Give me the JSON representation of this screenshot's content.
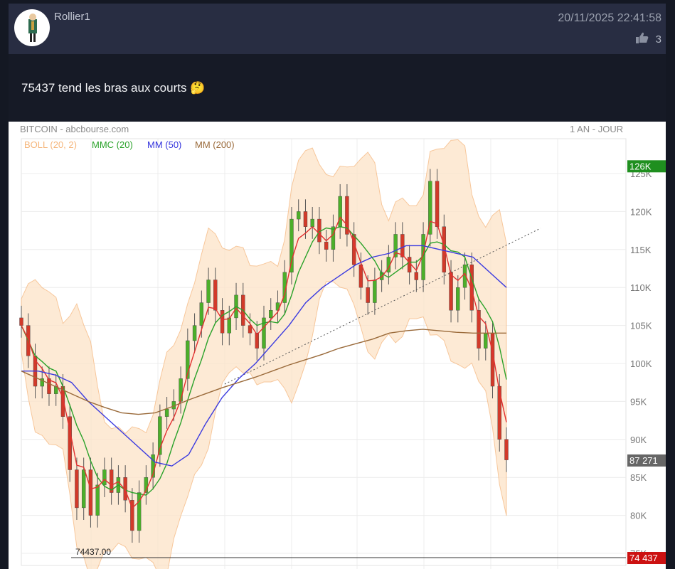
{
  "post": {
    "username": "Rollier1",
    "timestamp": "20/11/2025 22:41:58",
    "likes": "3",
    "message": "75437 tend les bras aux courts",
    "emoji": "🤔"
  },
  "chart_data": {
    "type": "candlestick",
    "title": "BITCOIN - abcbourse.com",
    "period": "1 AN - JOUR",
    "legend": [
      {
        "label": "BOLL (20, 2)",
        "color": "#f5b57a"
      },
      {
        "label": "MMC (20)",
        "color": "#2aa22a"
      },
      {
        "label": "MM (50)",
        "color": "#3333dd"
      },
      {
        "label": "MM (200)",
        "color": "#9a6a3a"
      }
    ],
    "y_ticks": [
      "125K",
      "120K",
      "115K",
      "110K",
      "105K",
      "100K",
      "95K",
      "90K",
      "85K",
      "80K",
      "75K"
    ],
    "ylim": [
      74,
      129
    ],
    "last_price_label": "87 271",
    "last_price": 87.271,
    "high_label": "126K",
    "low_label": "74 437",
    "low_line_label": "74437.00",
    "low": 74.437,
    "closes": [
      105,
      101,
      97,
      98,
      96,
      97,
      93,
      86,
      81,
      86,
      80,
      84,
      86,
      83,
      85,
      82,
      78,
      83,
      85,
      88,
      93,
      94,
      95,
      98,
      103,
      105,
      108,
      111,
      107,
      104,
      106,
      109,
      105,
      104,
      102,
      106,
      107,
      108,
      112,
      119,
      120,
      118,
      119,
      116,
      115,
      118,
      122,
      117,
      113,
      110,
      108,
      111,
      112,
      114,
      117,
      114,
      112,
      111,
      117,
      124,
      118,
      112,
      107,
      110,
      113,
      107,
      102,
      104,
      97,
      90,
      87.3
    ],
    "ma50": [
      99,
      99,
      98.5,
      97.5,
      95,
      93,
      91,
      89,
      87,
      86.5,
      88,
      92,
      95.5,
      98,
      100,
      102.5,
      105,
      108,
      110,
      111.5,
      113,
      114,
      114.5,
      115.5,
      115.5,
      115,
      114.5,
      114,
      112,
      110
    ],
    "ma200": [
      99,
      98,
      97,
      96,
      95,
      94.2,
      93.5,
      93.3,
      93.5,
      94.3,
      95.2,
      96,
      96.8,
      97.5,
      98.2,
      99,
      99.8,
      100.5,
      101.2,
      102,
      102.6,
      103.2,
      104,
      104.3,
      104.5,
      104.3,
      104.1,
      104,
      104,
      104
    ]
  }
}
